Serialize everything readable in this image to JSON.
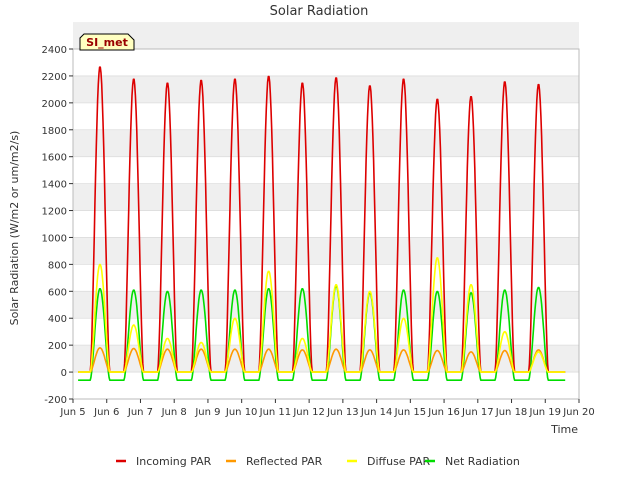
{
  "chart_data": {
    "type": "line",
    "title": "Solar Radiation",
    "xlabel": "Time",
    "ylabel": "Solar Radiation (W/m2 or um/m2/s)",
    "site_label": "SI_met",
    "x_unit": "day of June",
    "xlim": [
      5,
      20
    ],
    "ylim": [
      -200,
      2400
    ],
    "grid": "horizontal bands",
    "legend_position": "bottom",
    "x_ticks": [
      {
        "value": 5,
        "label": "Jun 5"
      },
      {
        "value": 6,
        "label": "Jun 6"
      },
      {
        "value": 7,
        "label": "Jun 7"
      },
      {
        "value": 8,
        "label": "Jun 8"
      },
      {
        "value": 9,
        "label": "Jun 9"
      },
      {
        "value": 10,
        "label": "Jun 10"
      },
      {
        "value": 11,
        "label": "Jun 11"
      },
      {
        "value": 12,
        "label": "Jun 12"
      },
      {
        "value": 13,
        "label": "Jun 13"
      },
      {
        "value": 14,
        "label": "Jun 14"
      },
      {
        "value": 15,
        "label": "Jun 15"
      },
      {
        "value": 16,
        "label": "Jun 16"
      },
      {
        "value": 17,
        "label": "Jun 17"
      },
      {
        "value": 18,
        "label": "Jun 18"
      },
      {
        "value": 19,
        "label": "Jun 19"
      },
      {
        "value": 20,
        "label": "Jun 20"
      }
    ],
    "y_ticks": [
      -200,
      0,
      200,
      400,
      600,
      800,
      1000,
      1200,
      1400,
      1600,
      1800,
      2000,
      2200,
      2400
    ],
    "days": [
      5.8,
      6.8,
      7.8,
      8.8,
      9.8,
      10.8,
      11.8,
      12.8,
      13.8,
      14.8,
      15.8,
      16.8,
      17.8,
      18.8
    ],
    "series": [
      {
        "name": "Incoming PAR",
        "color": "#dd0000",
        "daily_peak": [
          2270,
          2180,
          2150,
          2170,
          2180,
          2200,
          2150,
          2190,
          2130,
          2180,
          2030,
          2050,
          2160,
          2140
        ],
        "night_value": 0
      },
      {
        "name": "Reflected PAR",
        "color": "#ff9900",
        "daily_peak": [
          180,
          175,
          170,
          170,
          170,
          170,
          165,
          170,
          165,
          165,
          160,
          150,
          160,
          165
        ],
        "night_value": 0
      },
      {
        "name": "Diffuse PAR",
        "color": "#ffff00",
        "daily_peak": [
          800,
          350,
          250,
          220,
          400,
          750,
          250,
          650,
          600,
          400,
          850,
          650,
          300,
          150
        ],
        "night_value": 0
      },
      {
        "name": "Net Radiation",
        "color": "#00dd00",
        "daily_peak": [
          620,
          610,
          600,
          610,
          610,
          620,
          620,
          640,
          590,
          610,
          600,
          590,
          610,
          630
        ],
        "night_value": -60
      }
    ]
  }
}
